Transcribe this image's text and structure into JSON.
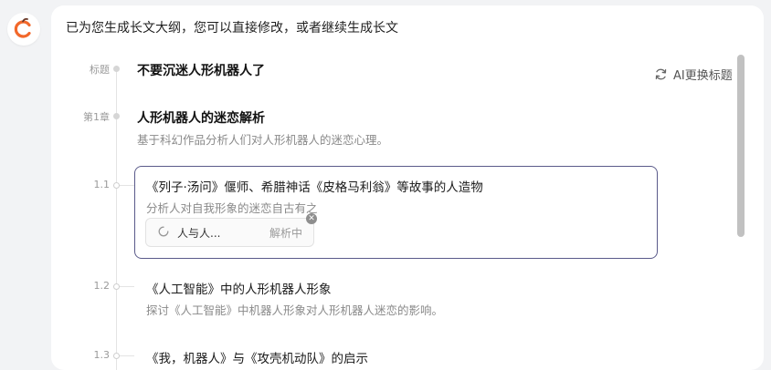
{
  "intro_text": "已为您生成长文大纲，您可以直接修改，或者继续生成长文",
  "ai_button_label": "AI更换标题",
  "outline": {
    "title": {
      "label": "标题",
      "text": "不要沉迷人形机器人了"
    },
    "chapter": {
      "label": "第1章",
      "title": "人形机器人的迷恋解析",
      "desc": "基于科幻作品分析人们对人形机器人的迷恋心理。"
    },
    "sections": [
      {
        "label": "1.1",
        "title": "《列子·汤问》偃师、希腊神话《皮格马利翁》等故事的人造物",
        "desc": "分析人对自我形象的迷恋自古有之",
        "attachment": {
          "name": "人与人...",
          "status": "解析中"
        }
      },
      {
        "label": "1.2",
        "title": "《人工智能》中的人形机器人形象",
        "desc": "探讨《人工智能》中机器人形象对人形机器人迷恋的影响。"
      },
      {
        "label": "1.3",
        "title": "《我，机器人》与《攻壳机动队》的启示"
      }
    ]
  },
  "icons": {
    "avatar": "app-logo-icon",
    "refresh": "refresh-icon",
    "spinner": "loading-spinner-icon",
    "close": "close-icon"
  },
  "colors": {
    "active_border": "#5a5a8a",
    "logo_orange": "#f2682b",
    "muted_text": "#8a8a8a"
  }
}
